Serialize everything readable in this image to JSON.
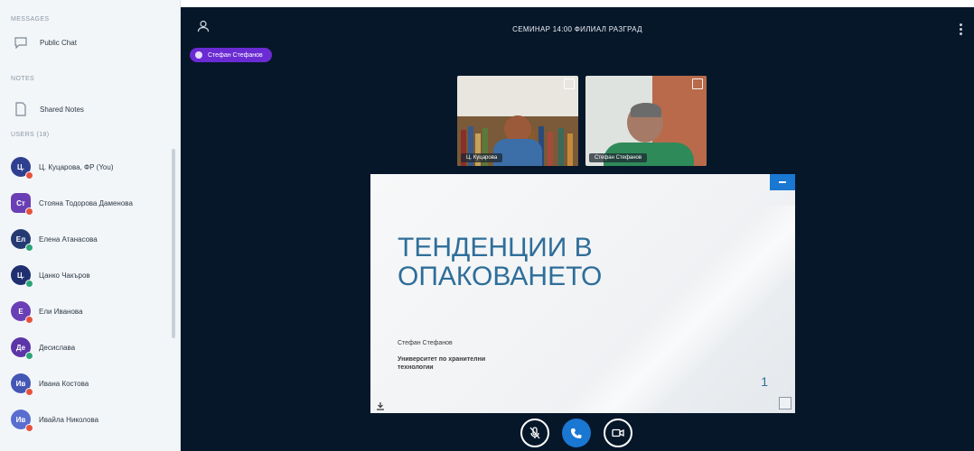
{
  "sidebar": {
    "messages_label": "MESSAGES",
    "public_chat": "Public Chat",
    "notes_label": "NOTES",
    "shared_notes": "Shared Notes",
    "users_label": "USERS (18)",
    "users": [
      {
        "initials": "Ц.",
        "name": "Ц. Куцарова, ФР (You)",
        "color": "#2f3f8f",
        "status": "#e5533d",
        "shape": "round"
      },
      {
        "initials": "Ст",
        "name": "Стояна Тодорова Даменова",
        "color": "#6a3fb5",
        "status": "#e5533d",
        "shape": "square"
      },
      {
        "initials": "Ел",
        "name": "Елена Атанасова",
        "color": "#253a72",
        "status": "#2da37a",
        "shape": "round"
      },
      {
        "initials": "Ц.",
        "name": "Цанко Чакъров",
        "color": "#1f2f70",
        "status": "#2da37a",
        "shape": "round"
      },
      {
        "initials": "Е",
        "name": "Ели Иванова",
        "color": "#6a3fb5",
        "status": "#e5533d",
        "shape": "round"
      },
      {
        "initials": "Дe",
        "name": "Десислава",
        "color": "#5c35a8",
        "status": "#2da37a",
        "shape": "round"
      },
      {
        "initials": "Ив",
        "name": "Ивана Костова",
        "color": "#4457b5",
        "status": "#e5533d",
        "shape": "round"
      },
      {
        "initials": "Ив",
        "name": "Ивайла Николова",
        "color": "#5a6ed0",
        "status": "#e5533d",
        "shape": "round"
      }
    ]
  },
  "header": {
    "meeting_title": "СЕМИНАР 14:00 ФИЛИАЛ РАЗГРАД",
    "presenter": "Стефан Стефанов"
  },
  "videos": [
    {
      "label": "Ц. Куцарова"
    },
    {
      "label": "Стефан Стефанов"
    }
  ],
  "slide": {
    "title_line1": "ТЕНДЕНЦИИ В",
    "title_line2": "ОПАКОВАНЕТО",
    "author": "Стефан Стефанов",
    "org_line1": "Университет по хранителни",
    "org_line2": "технологии",
    "page_number": "1"
  },
  "icons": {
    "chat": "chat-bubble-icon",
    "notes": "notes-icon",
    "user": "user-icon",
    "mic": "mic-off-icon",
    "phone": "phone-icon",
    "camera": "camera-icon"
  }
}
